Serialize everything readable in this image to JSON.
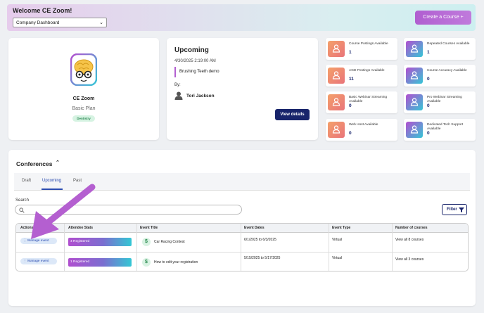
{
  "header": {
    "welcome": "Welcome CE Zoom!",
    "company_select": "Company Dashboard",
    "create_course": "Create a Course +"
  },
  "profile": {
    "name": "CE Zoom",
    "plan": "Basic Plan",
    "tag": "Dentistry"
  },
  "upcoming": {
    "title": "Upcoming",
    "datetime": "4/30/2025 2:19:00 AM",
    "event": "Brushing Teeth demo",
    "by_label": "By:",
    "person": "Tori Jackson",
    "view_details": "View details"
  },
  "stats": [
    {
      "label": "Course Postings Available",
      "value": "1",
      "color": "orange"
    },
    {
      "label": "Repeated Courses Available",
      "value": "1",
      "color": "purple"
    },
    {
      "label": "AGD Postings Available",
      "value": "11",
      "color": "orange"
    },
    {
      "label": "Course Accuracy Available",
      "value": "0",
      "color": "purple"
    },
    {
      "label": "Basic Webinar Streaming Available",
      "value": "0",
      "color": "orange"
    },
    {
      "label": "Pro Webinar Streaming Available",
      "value": "0",
      "color": "purple"
    },
    {
      "label": "Web Host Available",
      "value": "0",
      "color": "orange"
    },
    {
      "label": "Dedicated Tech Support Available",
      "value": "0",
      "color": "purple"
    }
  ],
  "conferences": {
    "title": "Conferences",
    "tabs": [
      "Draft",
      "Upcoming",
      "Past"
    ],
    "active_tab": "Upcoming",
    "search_label": "Search",
    "filter": "Filter",
    "columns": [
      "Actions",
      "Attendee Stats",
      "Event Title",
      "Event Dates",
      "Event Type",
      "Number of courses"
    ],
    "rows": [
      {
        "action": "⋮ Manage event",
        "registered": "4 Registered",
        "title": "Car Racing Contest",
        "dates": "6/1/2025 to 6/3/2025",
        "type": "Virtual",
        "courses": "View all 8 courses"
      },
      {
        "action": "⋮ Manage event",
        "registered": "1 Registered",
        "title": "How to edit your registration",
        "dates": "5/15/2025 to 5/17/2025",
        "type": "Virtual",
        "courses": "View all 3 courses"
      }
    ]
  },
  "colors": {
    "accent": "#b05ed0",
    "navy": "#18246b",
    "link": "#2a4bb0",
    "annotation_arrow": "#b45fd0"
  }
}
